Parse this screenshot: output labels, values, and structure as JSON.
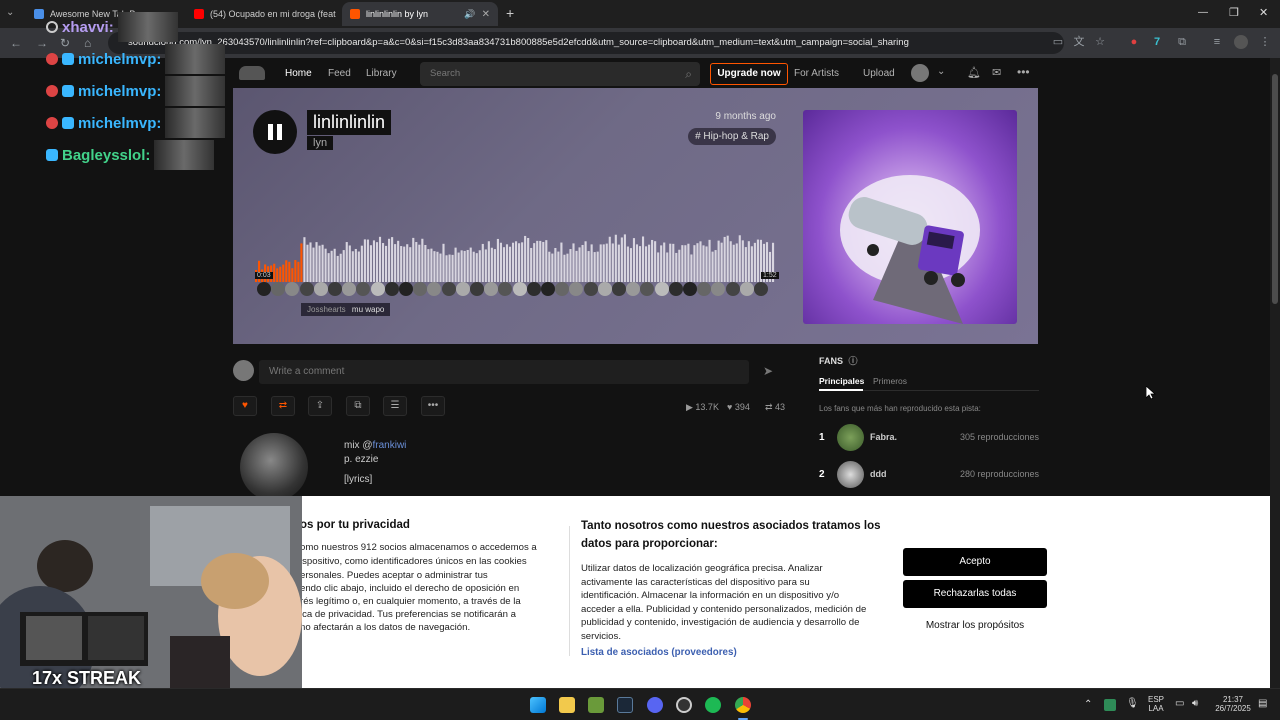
{
  "browser": {
    "tabs": [
      {
        "title": "Awesome New Tab Pa",
        "favcolor": "#4a8fe8"
      },
      {
        "title": "(54) Ocupado en mi droga (feat",
        "favcolor": "#ff0000"
      },
      {
        "title": "linlinlinlin by lyn",
        "favcolor": "#ff5500"
      }
    ],
    "new_tab": "+",
    "url": "soundcloud.com/lyn_263043570/linlinlinlin?ref=clipboard&p=a&c=0&si=f15c3d83aa834731b800885e5d2efcdd&utm_source=clipboard&utm_medium=text&utm_campaign=social_sharing",
    "window_controls": [
      "—",
      "❐",
      "✕"
    ]
  },
  "stream_chat": [
    {
      "user": "xhavvi:",
      "color": "#b59cf0"
    },
    {
      "user": "michelmvp:",
      "color": "#3ab7ff"
    },
    {
      "user": "michelmvp:",
      "color": "#3ab7ff"
    },
    {
      "user": "michelmvp:",
      "color": "#3ab7ff"
    },
    {
      "user": "Bagleysslol:",
      "color": "#42d28a"
    }
  ],
  "streak": "17x STREAK",
  "soundcloud": {
    "nav": {
      "home": "Home",
      "feed": "Feed",
      "library": "Library",
      "search_placeholder": "Search",
      "upgrade": "Upgrade now",
      "for_artists": "For Artists",
      "upload": "Upload"
    },
    "track": {
      "title": "linlinlinlin",
      "artist": "lyn",
      "time_ago": "9 months ago",
      "genre": "# Hip-hop & Rap",
      "elapsed": "0:03",
      "duration": "1:52",
      "progress": 0.09,
      "comment_user": "Josshearts",
      "comment_text": "mu wapo"
    },
    "comment_placeholder": "Write a comment",
    "stats": {
      "plays": "13.7K",
      "likes": "394",
      "reposts": "43"
    },
    "description": {
      "line1_prefix": "mix @",
      "line1_link": "frankiwi",
      "line2": "p. ezzie",
      "line3": "[lyrics]"
    },
    "fans": {
      "header": "FANS",
      "tab_top": "Principales",
      "tab_first": "Primeros",
      "subtitle": "Los fans que más han reproducido esta pista:",
      "rows": [
        {
          "rank": "1",
          "name": "Fabra.",
          "plays": "305 reproducciones"
        },
        {
          "rank": "2",
          "name": "ddd",
          "plays": "280 reproducciones"
        }
      ]
    }
  },
  "cookie": {
    "left_title": "os por tu privacidad",
    "left_lines": [
      "omo nuestros 912 socios almacenamos o accedemos a",
      "ispositivo, como identificadores únicos en las cookies",
      "ersonales. Puedes aceptar o administrar tus",
      "endo clic abajo, incluido el derecho de oposición en",
      "rés legítimo o, en cualquier momento, a través de la",
      "ica de privacidad. Tus preferencias se notificarán a",
      "no afectarán a los datos de navegación."
    ],
    "mid_title_1": "Tanto nosotros como nuestros asociados tratamos los",
    "mid_title_2": "datos para proporcionar:",
    "mid_lines": [
      "Utilizar datos de localización geográfica precisa. Analizar",
      "activamente las características del dispositivo para su",
      "identificación. Almacenar la información en un dispositivo y/o",
      "acceder a ella. Publicidad y contenido personalizados, medición de",
      "publicidad y contenido, investigación de audiencia y desarrollo de",
      "servicios."
    ],
    "vendors_link": "Lista de asociados (proveedores)",
    "accept": "Acepto",
    "reject": "Rechazarlas todas",
    "purposes": "Mostrar los propósitos"
  },
  "taskbar": {
    "lang_1": "ESP",
    "lang_2": "LAA",
    "time": "21:37",
    "date": "26/7/2025"
  }
}
